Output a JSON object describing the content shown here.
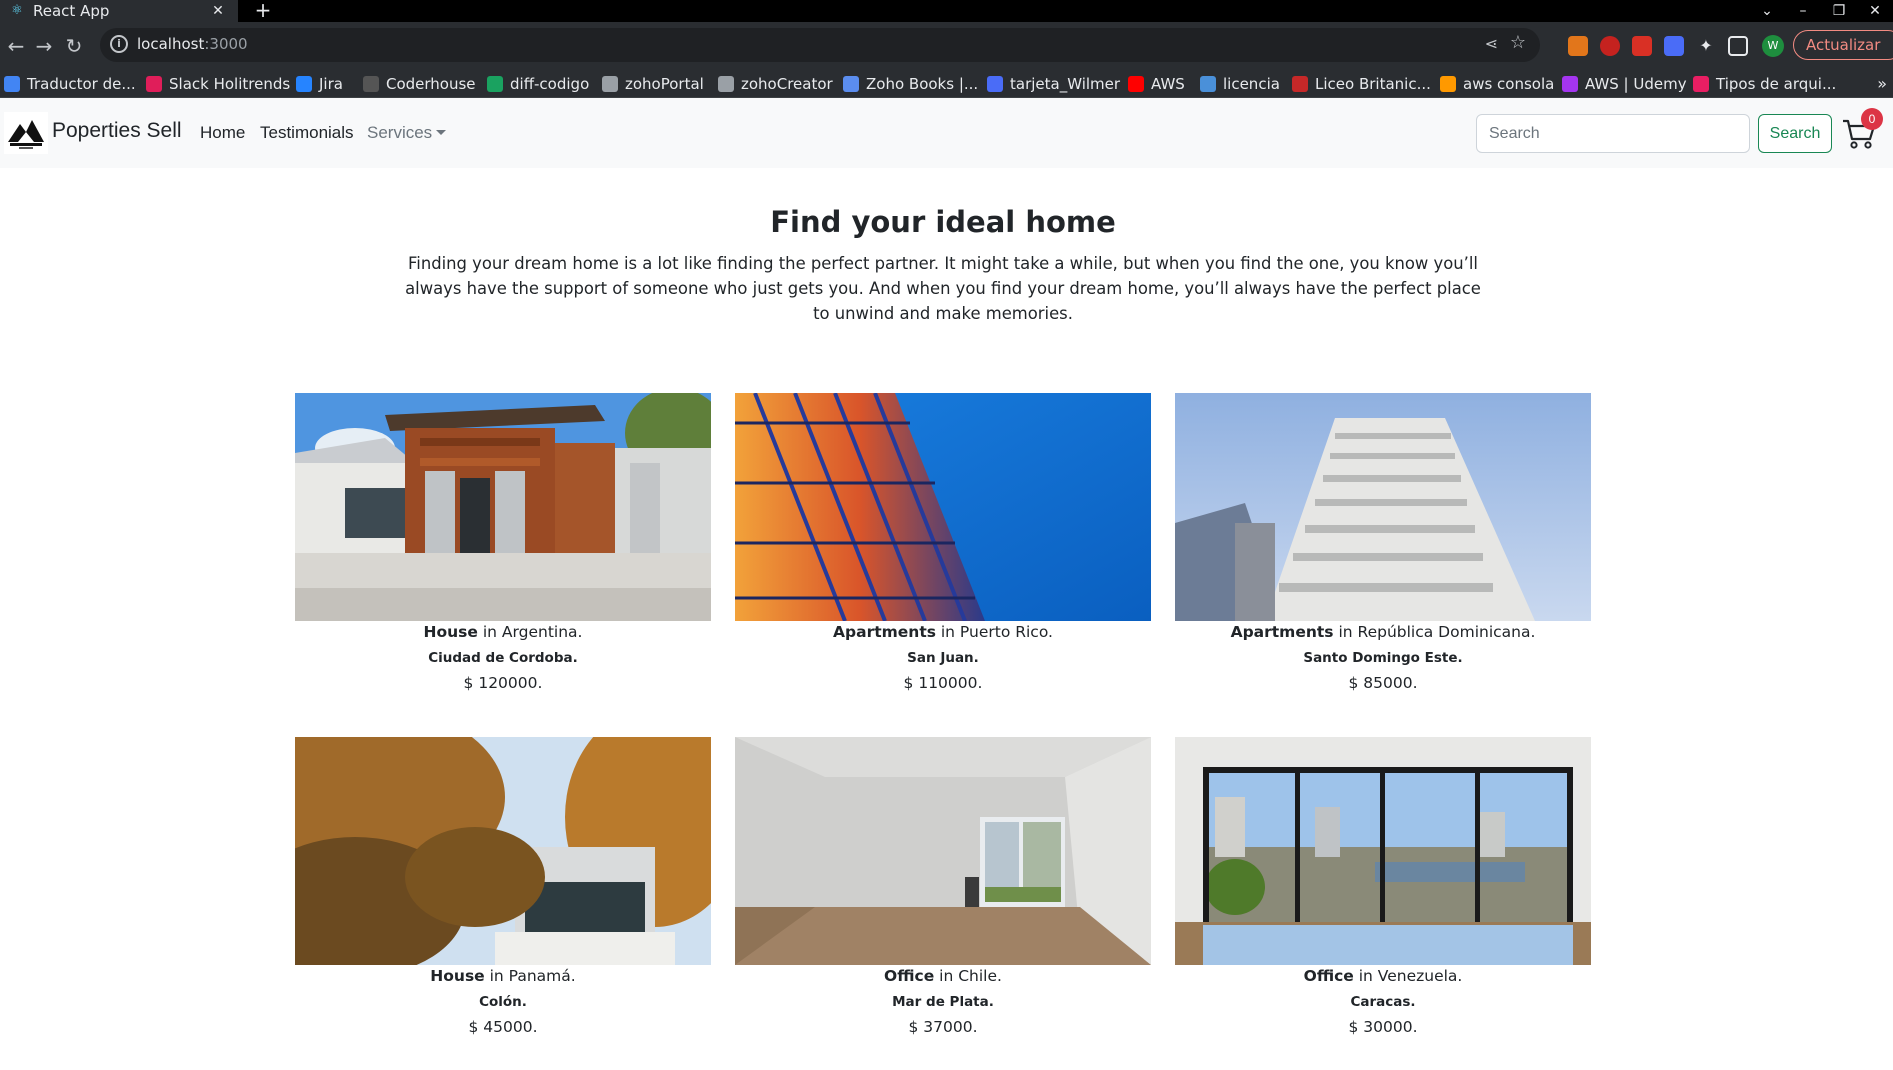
{
  "browser": {
    "tab_title": "React App",
    "url_host": "localhost",
    "url_port": ":3000",
    "update_label": "Actualizar",
    "profile_initial": "W",
    "bookmarks": [
      {
        "label": "Traductor de...",
        "color": "#4285f4"
      },
      {
        "label": "Slack Holitrends",
        "color": "#e01e5a"
      },
      {
        "label": "Jira",
        "color": "#2684ff"
      },
      {
        "label": "Coderhouse",
        "color": "#555555"
      },
      {
        "label": "diff-codigo",
        "color": "#1aa260"
      },
      {
        "label": "zohoPortal",
        "color": "#9aa0a6"
      },
      {
        "label": "zohoCreator",
        "color": "#9aa0a6"
      },
      {
        "label": "Zoho Books |...",
        "color": "#5b8def"
      },
      {
        "label": "tarjeta_Wilmer",
        "color": "#4a6cf7"
      },
      {
        "label": "AWS",
        "color": "#ff0000"
      },
      {
        "label": "licencia",
        "color": "#4a90d9"
      },
      {
        "label": "Liceo Britanic...",
        "color": "#c62828"
      },
      {
        "label": "aws consola",
        "color": "#ff9900"
      },
      {
        "label": "AWS | Udemy",
        "color": "#a435f0"
      },
      {
        "label": "Tipos de arqui...",
        "color": "#e91e63"
      }
    ]
  },
  "navbar": {
    "brand": "Poperties Sell",
    "links": {
      "home": "Home",
      "testimonials": "Testimonials",
      "services": "Services"
    },
    "search_placeholder": "Search",
    "search_button": "Search",
    "cart_count": "0"
  },
  "hero": {
    "title": "Find your ideal home",
    "text": "Finding your dream home is a lot like finding the perfect partner. It might take a while, but when you find the one, you know you’ll always have the support of someone who just gets you. And when you find your dream home, you’ll always have the perfect place to unwind and make memories."
  },
  "properties": [
    {
      "type": "House",
      "country": " in Argentina.",
      "city": "Ciudad de Cordoba.",
      "price": "$ 120000."
    },
    {
      "type": "Apartments",
      "country": " in Puerto Rico.",
      "city": "San Juan.",
      "price": "$ 110000."
    },
    {
      "type": "Apartments",
      "country": " in República Dominicana.",
      "city": "Santo Domingo Este.",
      "price": "$ 85000."
    },
    {
      "type": "House",
      "country": " in Panamá.",
      "city": "Colón.",
      "price": "$ 45000."
    },
    {
      "type": "Office",
      "country": " in Chile.",
      "city": "Mar de Plata.",
      "price": "$ 37000."
    },
    {
      "type": "Office",
      "country": " in Venezuela.",
      "city": "Caracas.",
      "price": "$ 30000."
    }
  ],
  "colors": {
    "success": "#198754",
    "danger": "#dc3545",
    "navbar_bg": "#f8f9fa"
  }
}
